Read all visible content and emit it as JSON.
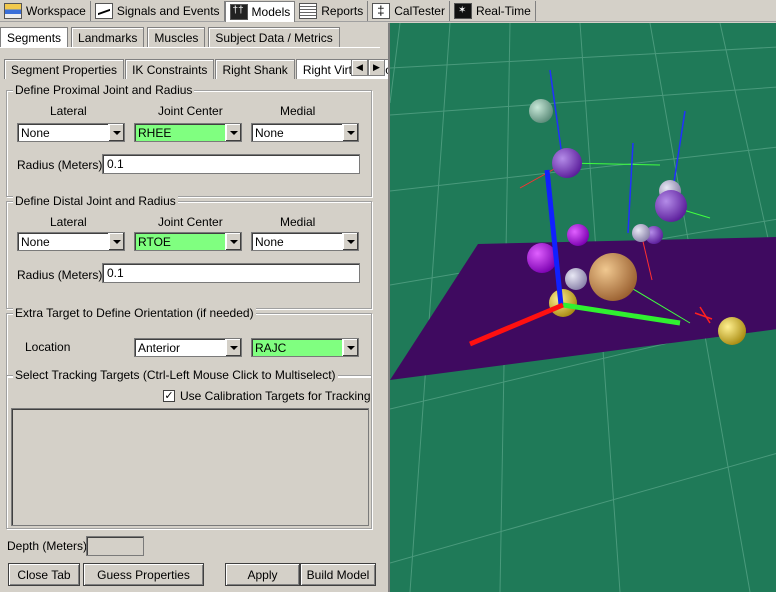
{
  "toolbar": {
    "items": [
      {
        "label": "Workspace",
        "icon": "workspace-icon"
      },
      {
        "label": "Signals and Events",
        "icon": "signals-icon"
      },
      {
        "label": "Models",
        "icon": "models-icon",
        "active": true
      },
      {
        "label": "Reports",
        "icon": "reports-icon"
      },
      {
        "label": "CalTester",
        "icon": "caltester-icon"
      },
      {
        "label": "Real-Time",
        "icon": "realtime-icon"
      }
    ]
  },
  "main_tabs": [
    "Segments",
    "Landmarks",
    "Muscles",
    "Subject Data / Metrics"
  ],
  "sub_tabs": [
    "Segment Properties",
    "IK Constraints",
    "Right Shank",
    "Right Virtual Foot"
  ],
  "proximal": {
    "title": "Define Proximal Joint and Radius",
    "lateral_label": "Lateral",
    "center_label": "Joint Center",
    "medial_label": "Medial",
    "lateral_value": "None",
    "center_value": "RHEE",
    "medial_value": "None",
    "radius_label": "Radius (Meters)",
    "radius_value": "0.1"
  },
  "distal": {
    "title": "Define Distal Joint and Radius",
    "lateral_label": "Lateral",
    "center_label": "Joint Center",
    "medial_label": "Medial",
    "lateral_value": "None",
    "center_value": "RTOE",
    "medial_value": "None",
    "radius_label": "Radius (Meters)",
    "radius_value": "0.1"
  },
  "orientation": {
    "title": "Extra Target to Define Orientation (if needed)",
    "location_label": "Location",
    "location_value": "Anterior",
    "target_value": "RAJC"
  },
  "tracking": {
    "title": "Select Tracking Targets (Ctrl-Left Mouse Click to Multiselect)",
    "checkbox_label": "Use Calibration Targets for Tracking",
    "checked": true
  },
  "depth": {
    "label": "Depth (Meters):",
    "value": ""
  },
  "buttons": {
    "close_tab": "Close Tab",
    "guess": "Guess Properties",
    "apply": "Apply",
    "build": "Build Model"
  },
  "colors": {
    "viewport_bg": "#1f7a58",
    "floor": "#3f0a60",
    "highlight_green": "#80ff80"
  }
}
